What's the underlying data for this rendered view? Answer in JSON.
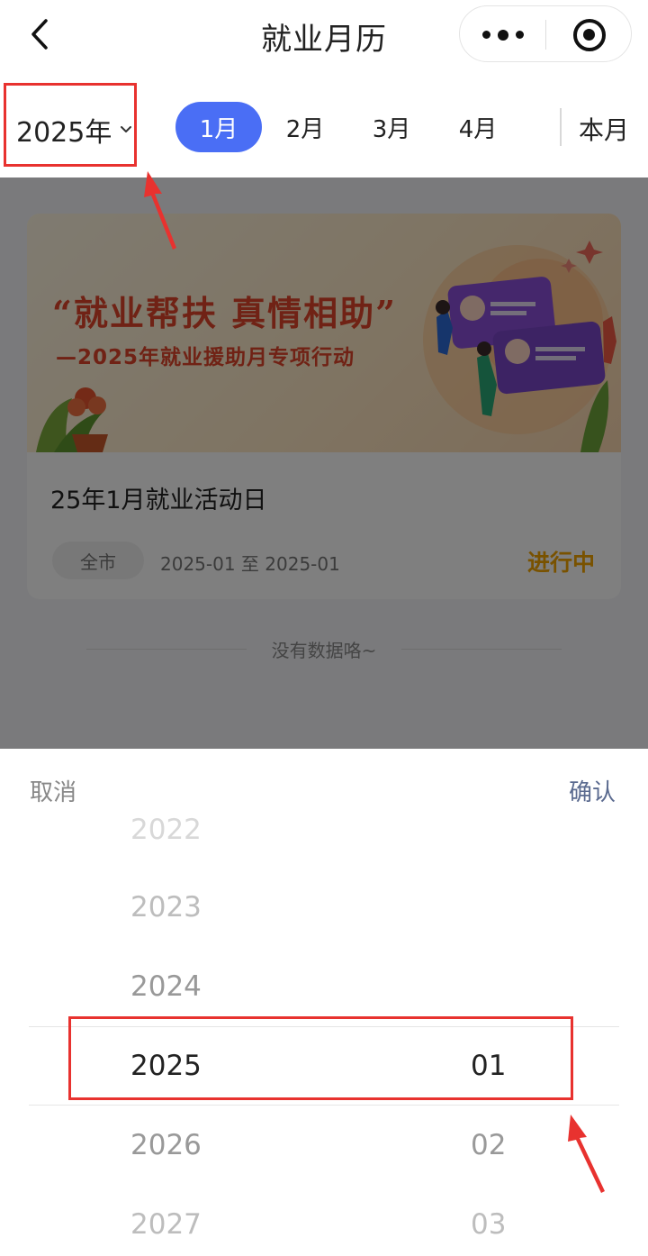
{
  "header": {
    "title": "就业月历",
    "back_icon": "chevron-left-icon",
    "more_icon": "more-dots-icon",
    "close_icon": "target-icon"
  },
  "month_bar": {
    "year_label": "2025年",
    "months": [
      "1月",
      "2月",
      "3月",
      "4月"
    ],
    "active_month_index": 0,
    "this_month_label": "本月",
    "accent_color": "#4a6ef5"
  },
  "activity": {
    "banner_title": "“就业帮扶 真情相助”",
    "banner_subtitle": "—2025年就业援助月专项行动",
    "title": "25年1月就业活动日",
    "tag": "全市",
    "date_range": "2025-01 至 2025-01",
    "status": "进行中",
    "status_color": "#f2a400"
  },
  "empty_hint": "没有数据咯~",
  "picker": {
    "cancel_label": "取消",
    "confirm_label": "确认",
    "years": [
      "2022",
      "2023",
      "2024",
      "2025",
      "2026",
      "2027"
    ],
    "selected_year": "2025",
    "months": [
      "01",
      "02",
      "03"
    ],
    "selected_month": "01"
  },
  "annotation_color": "#e8322f"
}
